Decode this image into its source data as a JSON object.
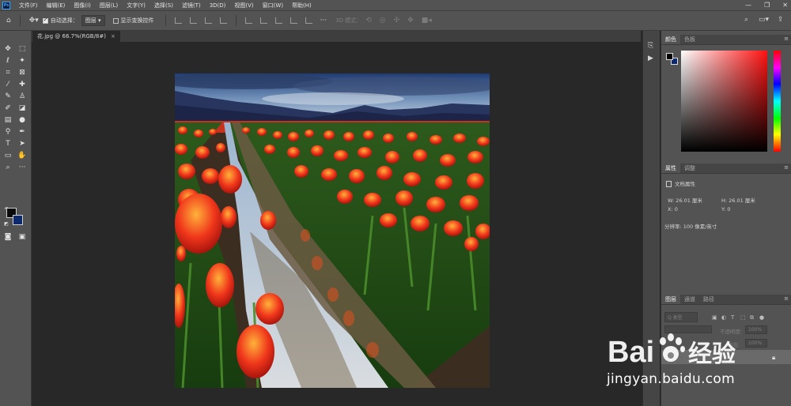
{
  "app": {
    "logo": "Ps"
  },
  "menu": [
    "文件(F)",
    "编辑(E)",
    "图像(I)",
    "图层(L)",
    "文字(Y)",
    "选择(S)",
    "滤镜(T)",
    "3D(D)",
    "视图(V)",
    "窗口(W)",
    "帮助(H)"
  ],
  "window_controls": {
    "minimize": "—",
    "restore": "❐",
    "close": "✕"
  },
  "options_bar": {
    "auto_select_label": "自动选择：",
    "auto_select_checked": true,
    "auto_select_target": "图层",
    "show_transform_label": "显示变换控件",
    "show_transform_checked": false,
    "mode_3d_label": "3D 模式："
  },
  "document": {
    "tab_title": "花.jpg @ 66.7%(RGB/8#)",
    "close": "×"
  },
  "panels": {
    "color": {
      "tabs": [
        "颜色",
        "色板"
      ],
      "fg_color": "#000000",
      "bg_color": "#0c2a6d"
    },
    "properties": {
      "tabs": [
        "属性",
        "调整"
      ],
      "doc_label": "文档属性",
      "w": "W:  26.01 厘米",
      "h": "H:  26.01 厘米",
      "x": "X:  0",
      "y": "Y:  0",
      "resolution": "分辨率: 100 像素/英寸"
    },
    "layers": {
      "tabs": [
        "图层",
        "通道",
        "路径"
      ],
      "kind_placeholder": "Q 类型",
      "opacity_label": "不透明度:",
      "opacity_value": "100%",
      "fill_label": "填充:",
      "fill_value": "100%"
    }
  },
  "watermark": {
    "brand_left": "Bai",
    "brand_right": "经验",
    "url": "jingyan.baidu.com"
  }
}
